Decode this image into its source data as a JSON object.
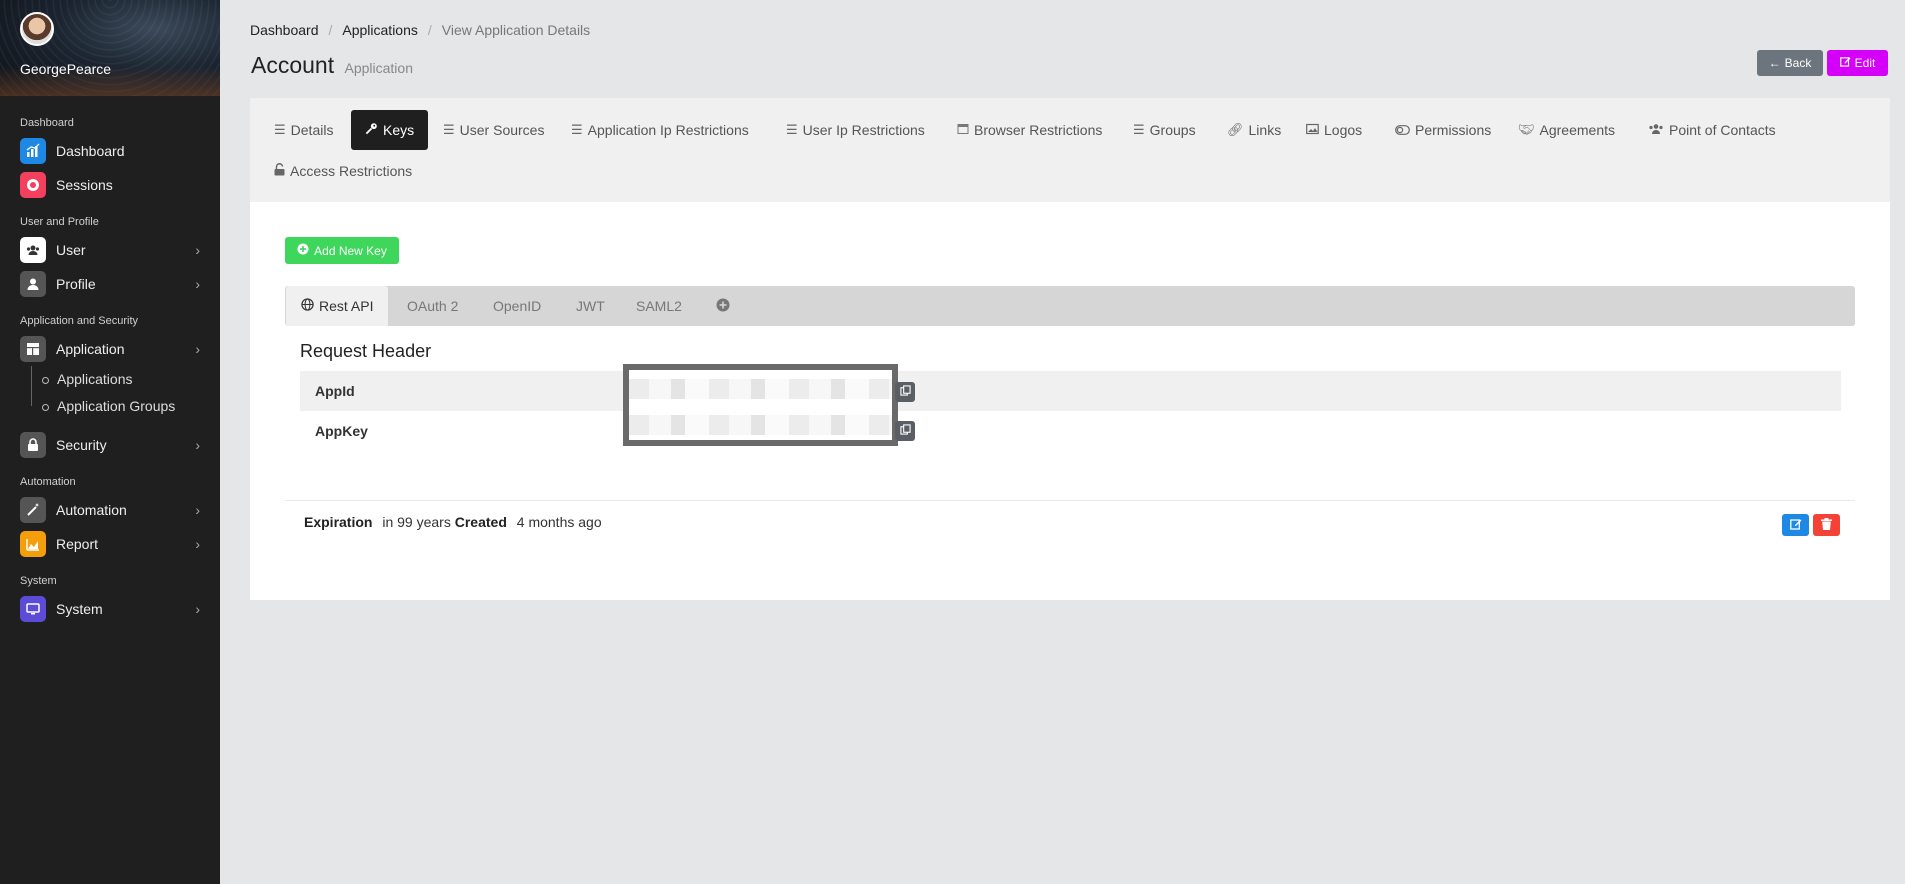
{
  "sidebar": {
    "username": "GeorgePearce",
    "sections": {
      "dashboard": "Dashboard",
      "user_profile": "User and Profile",
      "app_security": "Application and Security",
      "automation": "Automation",
      "system": "System"
    },
    "items": {
      "dashboard": "Dashboard",
      "sessions": "Sessions",
      "user": "User",
      "profile": "Profile",
      "application": "Application",
      "applications": "Applications",
      "application_groups": "Application Groups",
      "security": "Security",
      "automation": "Automation",
      "report": "Report",
      "system": "System"
    },
    "colors": {
      "dashboard": "#1e88e5",
      "sessions": "#f43f5e",
      "user": "#ffffff",
      "profile": "#555555",
      "application": "#555555",
      "security": "#555555",
      "automation": "#555555",
      "report": "#f59e0b",
      "system": "#5b4bd6"
    }
  },
  "breadcrumb": [
    "Dashboard",
    "Applications",
    "View Application Details"
  ],
  "page": {
    "title": "Account",
    "subtitle": "Application"
  },
  "actions": {
    "back": "Back",
    "edit": "Edit"
  },
  "tabs": [
    {
      "label": "Details",
      "icon": "list-icon"
    },
    {
      "label": "Keys",
      "icon": "key-icon"
    },
    {
      "label": "User Sources",
      "icon": "list-icon"
    },
    {
      "label": "Application Ip Restrictions",
      "icon": "list-icon"
    },
    {
      "label": "User Ip Restrictions",
      "icon": "list-icon"
    },
    {
      "label": "Browser Restrictions",
      "icon": "browser-icon"
    },
    {
      "label": "Groups",
      "icon": "list-icon"
    },
    {
      "label": "Links",
      "icon": "link-icon"
    },
    {
      "label": "Logos",
      "icon": "image-icon"
    },
    {
      "label": "Permissions",
      "icon": "toggle-icon"
    },
    {
      "label": "Agreements",
      "icon": "handshake-icon"
    },
    {
      "label": "Point of Contacts",
      "icon": "users-icon"
    },
    {
      "label": "Access Restrictions",
      "icon": "unlock-icon"
    }
  ],
  "active_tab": "Keys",
  "add_key_label": "Add New Key",
  "key_tabs": [
    "Rest API",
    "OAuth 2",
    "OpenID",
    "JWT",
    "SAML2"
  ],
  "request_header": {
    "title": "Request Header",
    "rows": [
      {
        "label": "AppId"
      },
      {
        "label": "AppKey"
      }
    ]
  },
  "expiration": {
    "label": "Expiration",
    "value": "in 99 years",
    "created_label": "Created",
    "created_value": "4 months ago"
  },
  "accent_colors": {
    "edit": "#d500f9",
    "add": "#3ed65b",
    "row_edit": "#1e88e5",
    "row_delete": "#f44336"
  }
}
